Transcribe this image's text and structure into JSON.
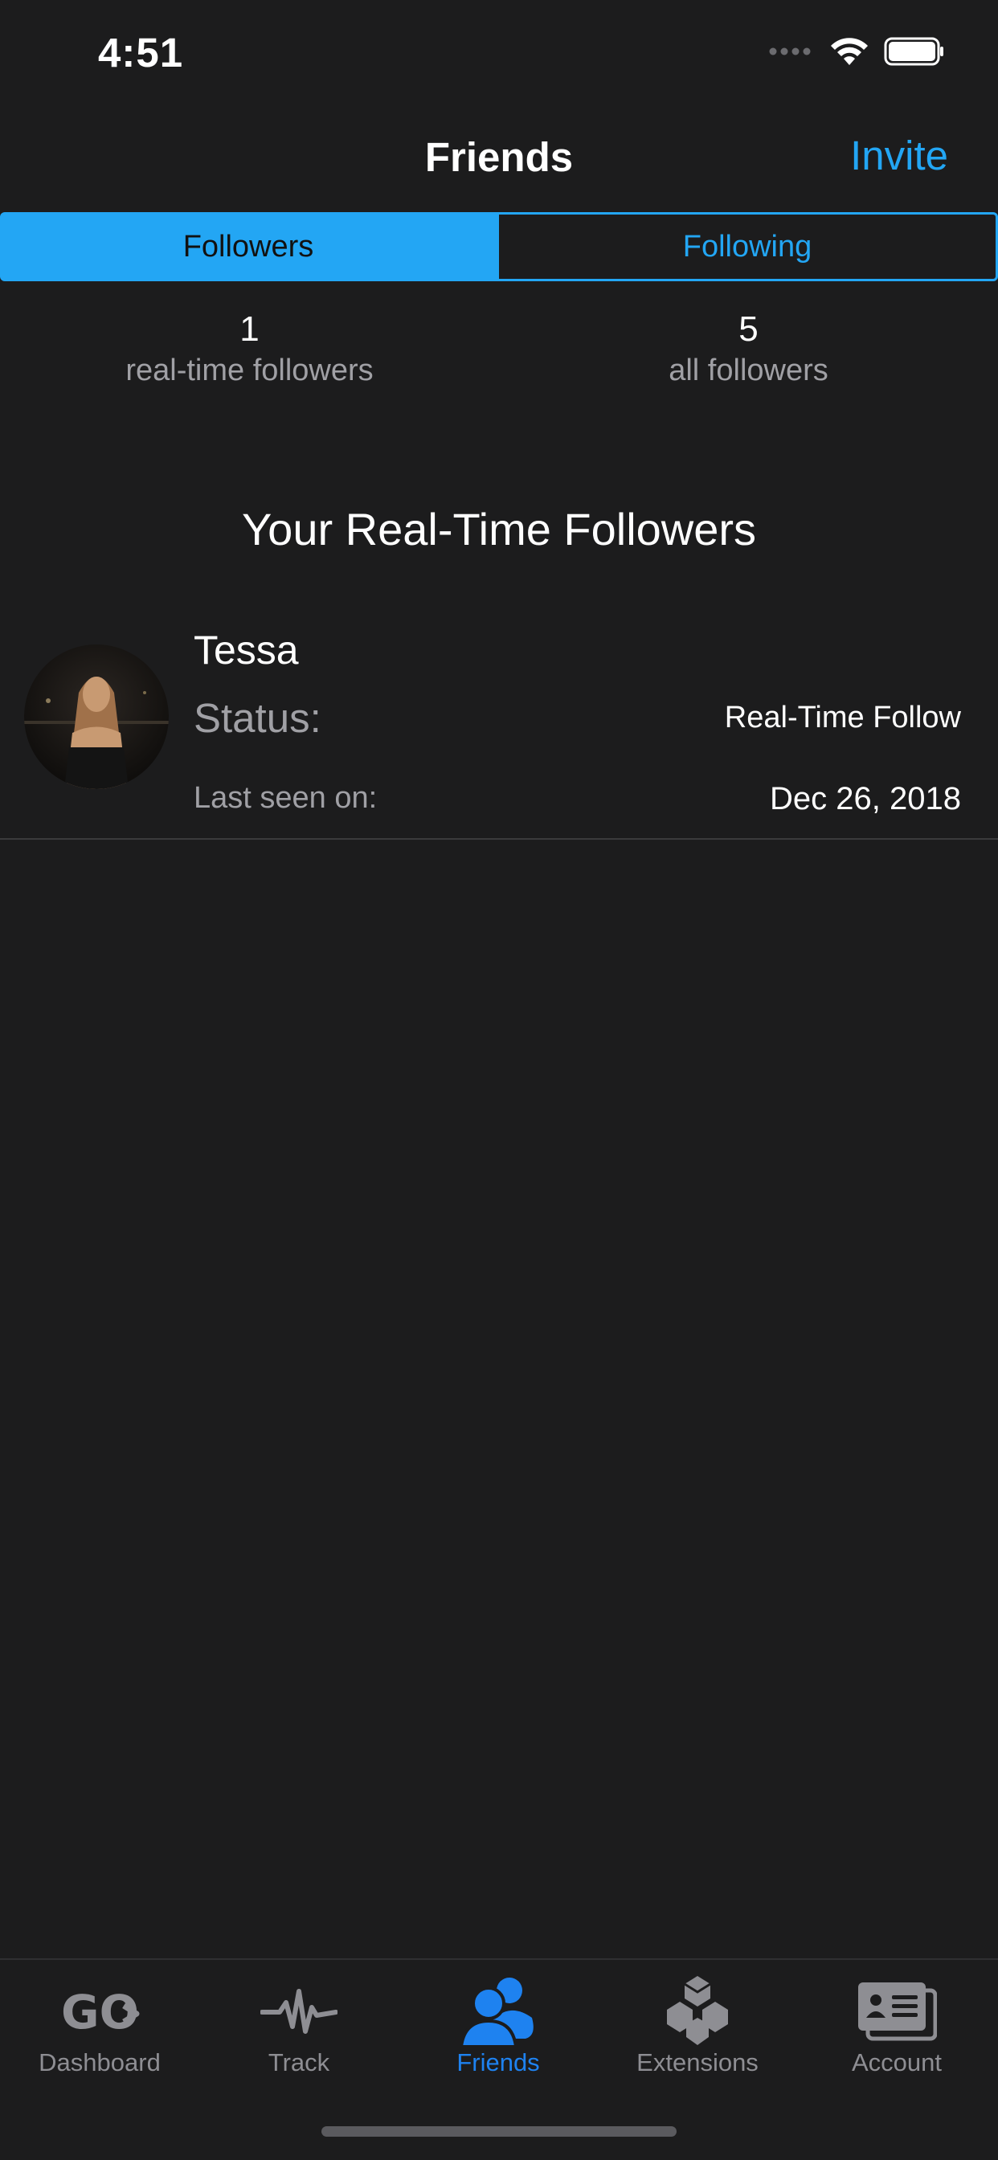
{
  "status_bar": {
    "time": "4:51"
  },
  "nav": {
    "title": "Friends",
    "invite_label": "Invite"
  },
  "segments": {
    "followers_label": "Followers",
    "following_label": "Following",
    "selected": "Followers"
  },
  "stats": {
    "realtime_count": "1",
    "realtime_label": "real-time followers",
    "all_count": "5",
    "all_label": "all followers"
  },
  "section": {
    "title": "Your Real-Time Followers"
  },
  "followers": [
    {
      "name": "Tessa",
      "status_label": "Status:",
      "status_value": "Real-Time Follow",
      "last_seen_label": "Last seen on:",
      "last_seen_value": "Dec 26, 2018"
    }
  ],
  "tab_bar": {
    "items": [
      {
        "label": "Dashboard",
        "icon": "go-logo-icon"
      },
      {
        "label": "Track",
        "icon": "pulse-icon"
      },
      {
        "label": "Friends",
        "icon": "friends-icon"
      },
      {
        "label": "Extensions",
        "icon": "cubes-icon"
      },
      {
        "label": "Account",
        "icon": "id-card-icon"
      }
    ],
    "active": "Friends"
  },
  "colors": {
    "accent": "#23a6f4",
    "tab_active": "#1e82f0",
    "background": "#1c1c1d",
    "secondary_text": "#a0a0a5"
  }
}
